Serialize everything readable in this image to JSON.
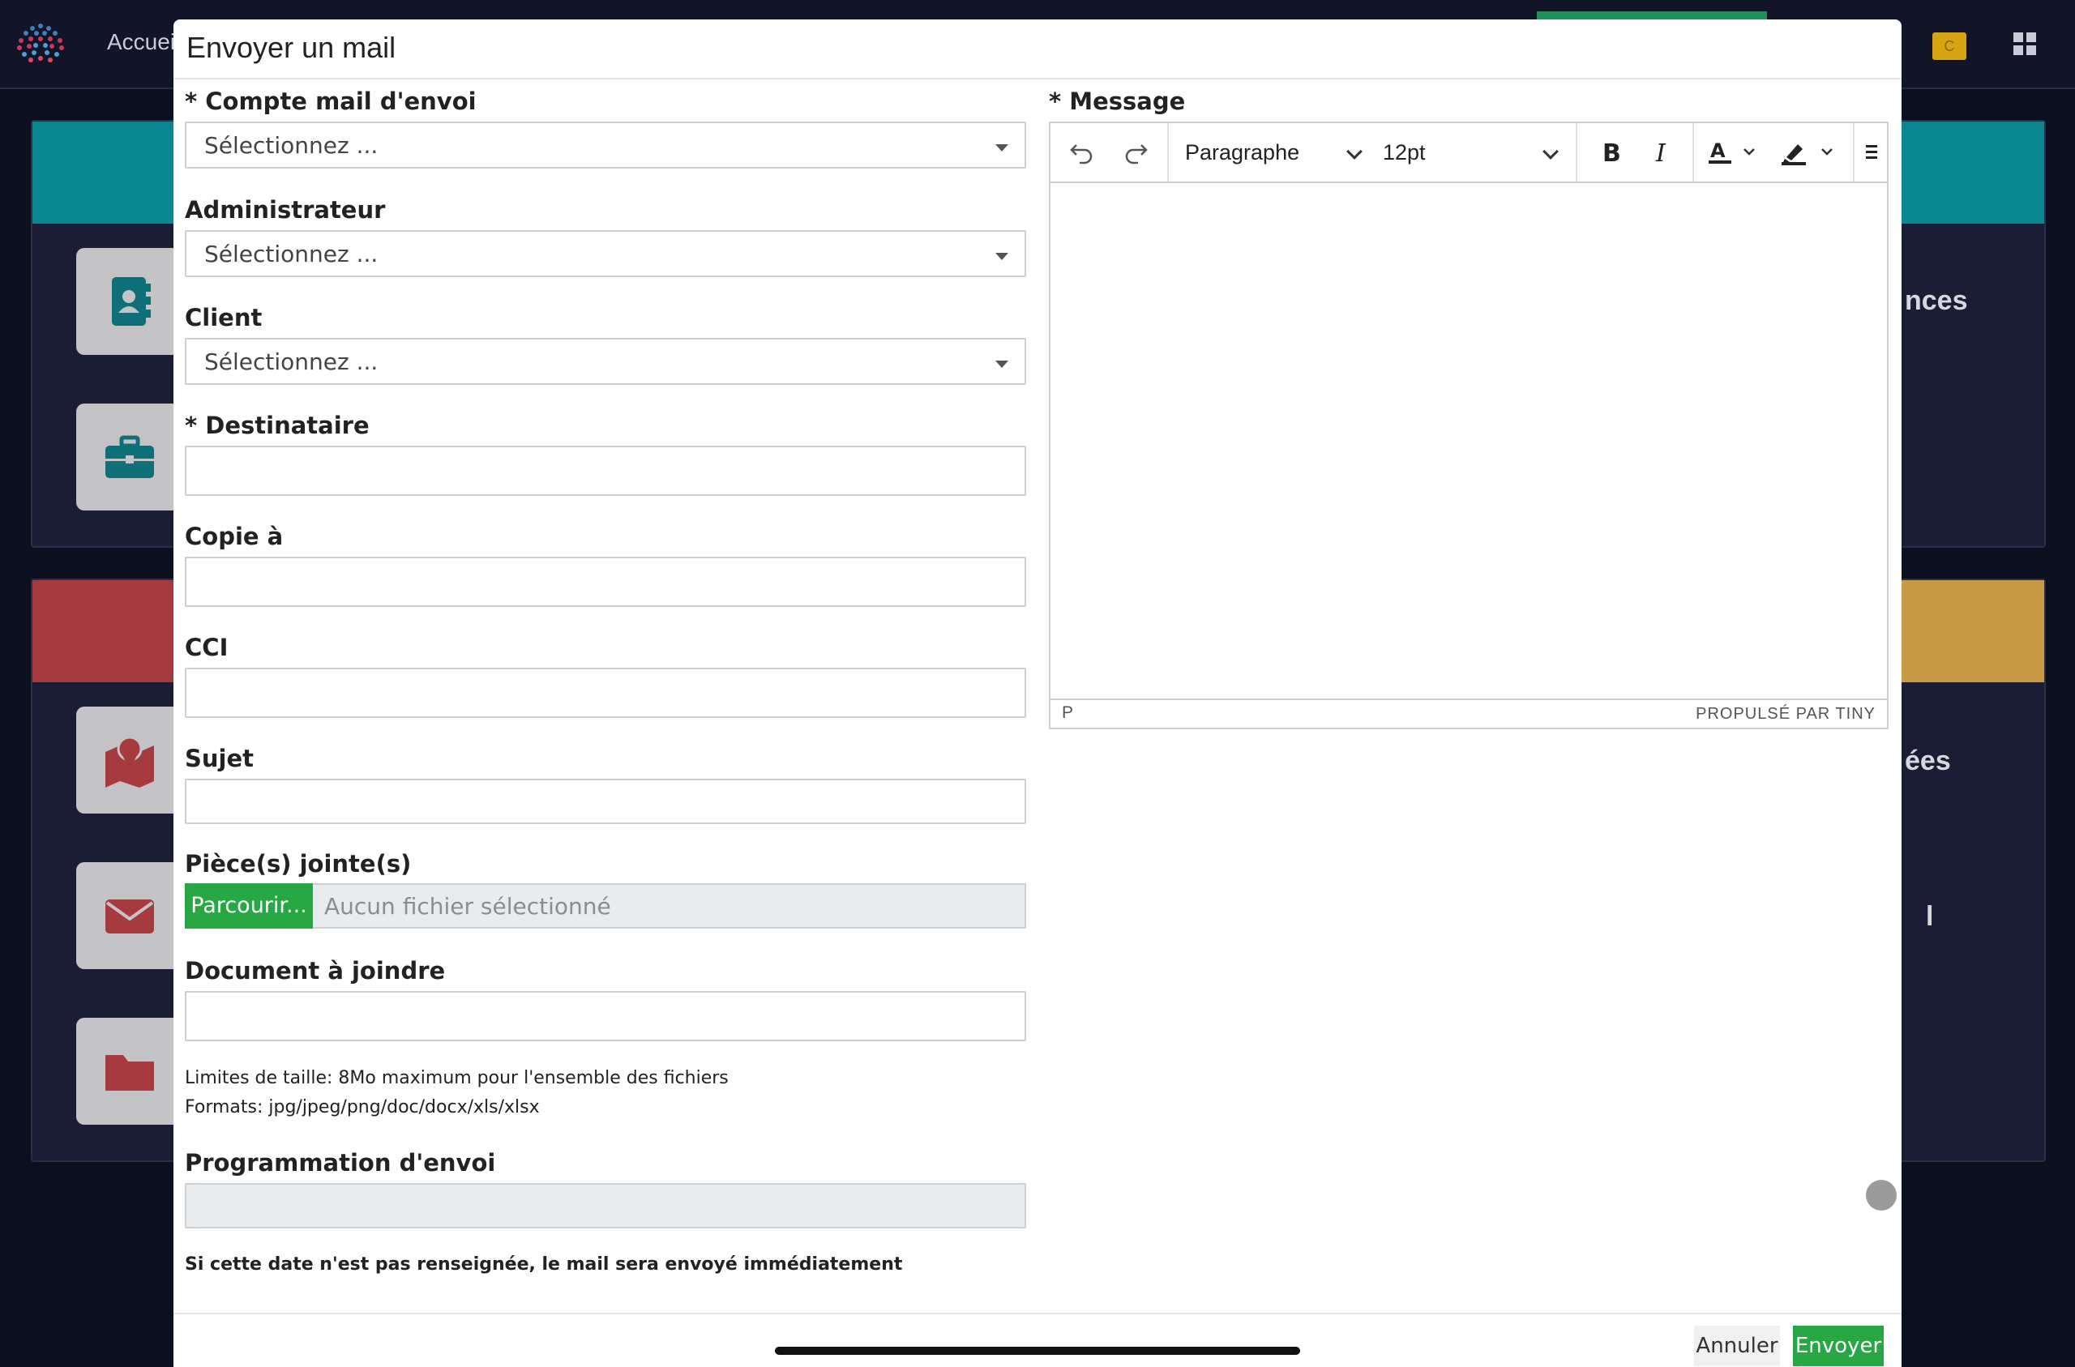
{
  "background": {
    "nav_home": "Accuei",
    "user_badge": "C",
    "partial_text_1": "nces",
    "partial_text_2": "ées",
    "partial_text_3": "l",
    "colors": {
      "teal_band": "#0a8690",
      "red_band": "#a63a3f",
      "yellow_band": "#c99a45"
    },
    "tile_icons": [
      "address-book-icon",
      "briefcase-icon",
      "map-pin-icon",
      "envelope-icon",
      "folder-icon"
    ]
  },
  "modal": {
    "title": "Envoyer un mail",
    "fields": {
      "sender_account": {
        "label": "* Compte mail d'envoi",
        "value": "Sélectionnez ..."
      },
      "administrator": {
        "label": "Administrateur",
        "value": "Sélectionnez ..."
      },
      "client": {
        "label": "Client",
        "value": "Sélectionnez ..."
      },
      "recipient": {
        "label": "* Destinataire",
        "value": ""
      },
      "cc": {
        "label": "Copie à",
        "value": ""
      },
      "bcc": {
        "label": "CCI",
        "value": ""
      },
      "subject": {
        "label": "Sujet",
        "value": ""
      },
      "attachments": {
        "label": "Pièce(s) jointe(s)",
        "browse": "Parcourir...",
        "placeholder": "Aucun fichier sélectionné"
      },
      "document": {
        "label": "Document à joindre",
        "value": ""
      },
      "schedule": {
        "label": "Programmation d'envoi",
        "value": ""
      }
    },
    "limits_text": "Limites de taille: 8Mo maximum pour l'ensemble des fichiers",
    "formats_text": "Formats: jpg/jpeg/png/doc/docx/xls/xlsx",
    "schedule_note": "Si cette date n'est pas renseignée, le mail sera envoyé immédiatement",
    "message": {
      "label": "* Message",
      "block_format": "Paragraphe",
      "font_size": "12pt",
      "status_element": "P",
      "powered_by": "PROPULSÉ PAR TINY"
    },
    "buttons": {
      "cancel": "Annuler",
      "send": "Envoyer"
    }
  }
}
